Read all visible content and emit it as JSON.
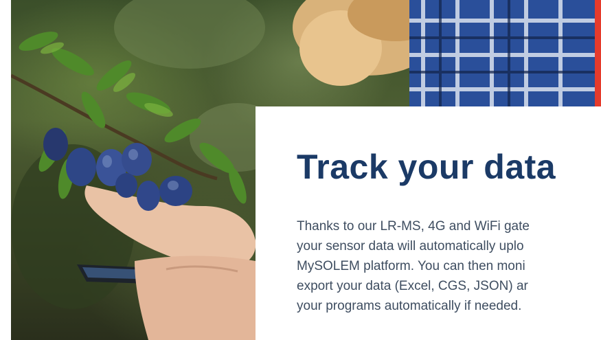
{
  "section": {
    "title": "Track your data",
    "body_lines": [
      "Thanks to our LR-MS, 4G and WiFi gate",
      "your sensor data will automatically uplo",
      "MySOLEM platform. You can then moni",
      "export your data (Excel, CGS, JSON) ar",
      "your programs automatically if needed."
    ]
  },
  "hero_image": {
    "icon": "photo-hand-holding-plums-and-phone"
  },
  "colors": {
    "title": "#1b3a66",
    "body": "#3e4d60",
    "accent": "#e53b2c",
    "card": "#ffffff"
  }
}
